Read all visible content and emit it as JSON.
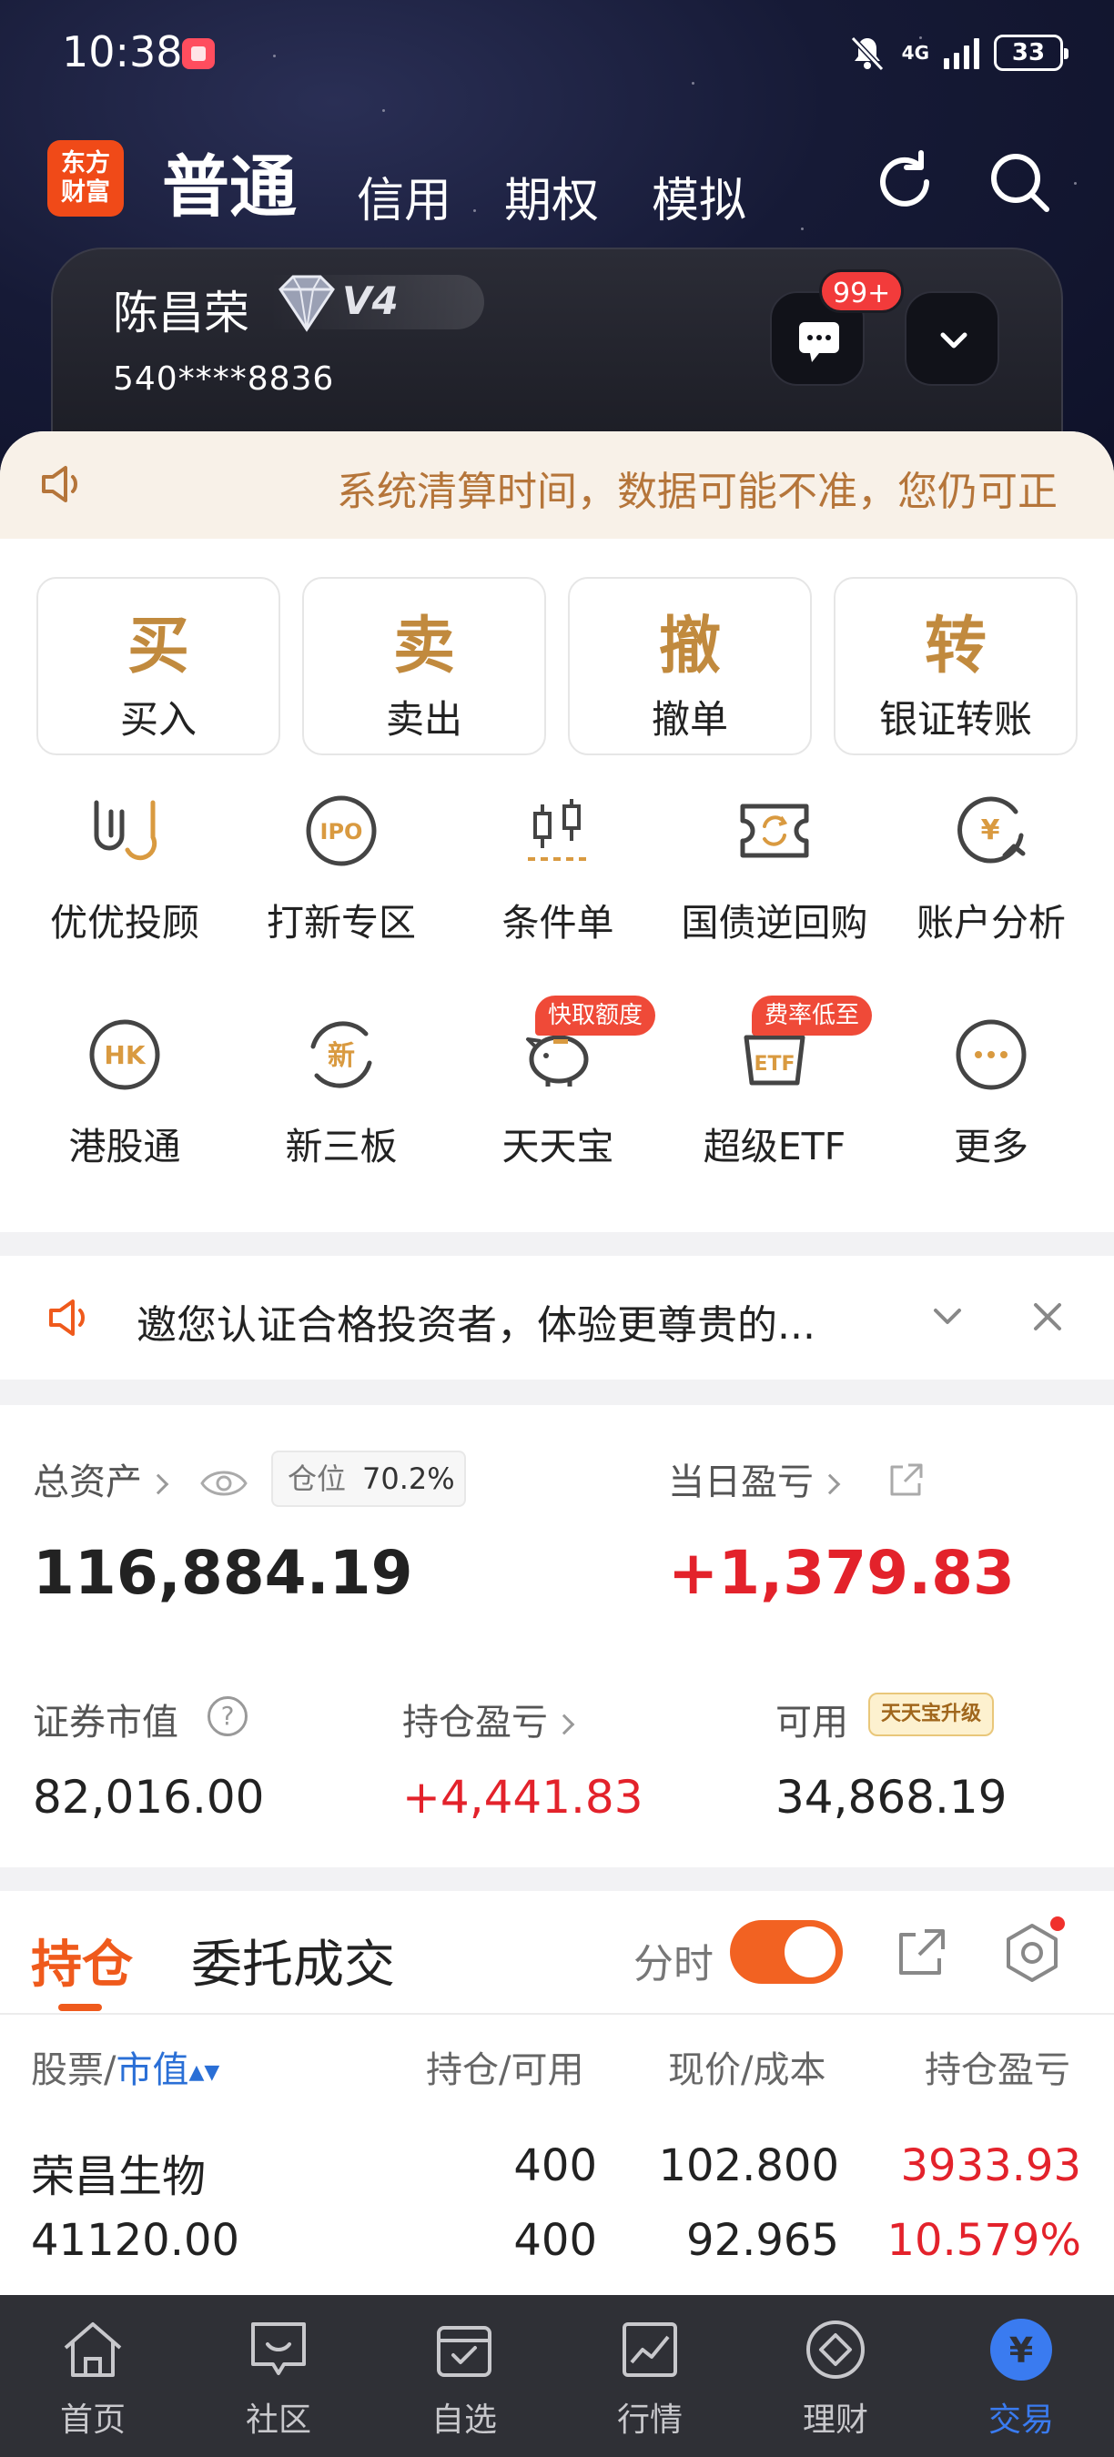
{
  "status_bar": {
    "time": "10:38",
    "network": "4G",
    "battery": "33"
  },
  "top_nav": {
    "logo": "东方\n财富",
    "tabs": [
      "普通",
      "信用",
      "期权",
      "模拟"
    ],
    "active_tab": "普通"
  },
  "account": {
    "name": "陈昌荣",
    "level": "V4",
    "number": "540****8836",
    "message_badge": "99+"
  },
  "ticker": {
    "text": "系统清算时间，数据可能不准，您仍可正"
  },
  "trade_buttons": [
    {
      "char": "买",
      "label": "买入"
    },
    {
      "char": "卖",
      "label": "卖出"
    },
    {
      "char": "撤",
      "label": "撤单"
    },
    {
      "char": "转",
      "label": "银证转账"
    }
  ],
  "features": [
    {
      "label": "优优投顾",
      "icon": "uu-advisor-icon"
    },
    {
      "label": "打新专区",
      "icon": "ipo-icon",
      "glyph": "IPO"
    },
    {
      "label": "条件单",
      "icon": "condition-order-icon"
    },
    {
      "label": "国债逆回购",
      "icon": "reverse-repo-icon"
    },
    {
      "label": "账户分析",
      "icon": "account-analysis-icon",
      "glyph": "¥"
    },
    {
      "label": "港股通",
      "icon": "hk-connect-icon",
      "glyph": "HK"
    },
    {
      "label": "新三板",
      "icon": "neeq-icon",
      "glyph": "新"
    },
    {
      "label": "天天宝",
      "icon": "piggy-bank-icon",
      "tag": "快取额度"
    },
    {
      "label": "超级ETF",
      "icon": "etf-icon",
      "glyph": "ETF",
      "tag": "费率低至"
    },
    {
      "label": "更多",
      "icon": "more-icon"
    }
  ],
  "notice": {
    "text": "邀您认证合格投资者，体验更尊贵的..."
  },
  "assets": {
    "total_label": "总资产",
    "position_label": "仓位",
    "position_value": "70.2%",
    "total_value": "116,884.19",
    "day_pl_label": "当日盈亏",
    "day_pl_value": "+1,379.83",
    "market_value_label": "证券市值",
    "market_value": "82,016.00",
    "holding_pl_label": "持仓盈亏",
    "holding_pl": "+4,441.83",
    "available_label": "可用",
    "available": "34,868.19",
    "upgrade_badge": "天天宝升级"
  },
  "holdings": {
    "tabs": [
      "持仓",
      "委托成交"
    ],
    "timeshare_label": "分时",
    "columns": {
      "stock": "股票/",
      "market_value": "市值",
      "qty": "持仓/可用",
      "price": "现价/成本",
      "pl": "持仓盈亏"
    },
    "rows": [
      {
        "name": "荣昌生物",
        "market_value": "41120.00",
        "qty": "400",
        "available": "400",
        "price": "102.800",
        "cost": "92.965",
        "pl": "3933.93",
        "pl_pct": "10.579%"
      }
    ]
  },
  "bottom_nav": [
    {
      "label": "首页",
      "icon": "home-icon"
    },
    {
      "label": "社区",
      "icon": "community-icon"
    },
    {
      "label": "自选",
      "icon": "watchlist-icon"
    },
    {
      "label": "行情",
      "icon": "market-icon"
    },
    {
      "label": "理财",
      "icon": "wealth-icon"
    },
    {
      "label": "交易",
      "icon": "trade-icon",
      "glyph": "¥"
    }
  ],
  "colors": {
    "accent_orange": "#ef5a1c",
    "gain_red": "#e3222b",
    "gold": "#c18a3e",
    "active_blue": "#3a7bf0"
  }
}
